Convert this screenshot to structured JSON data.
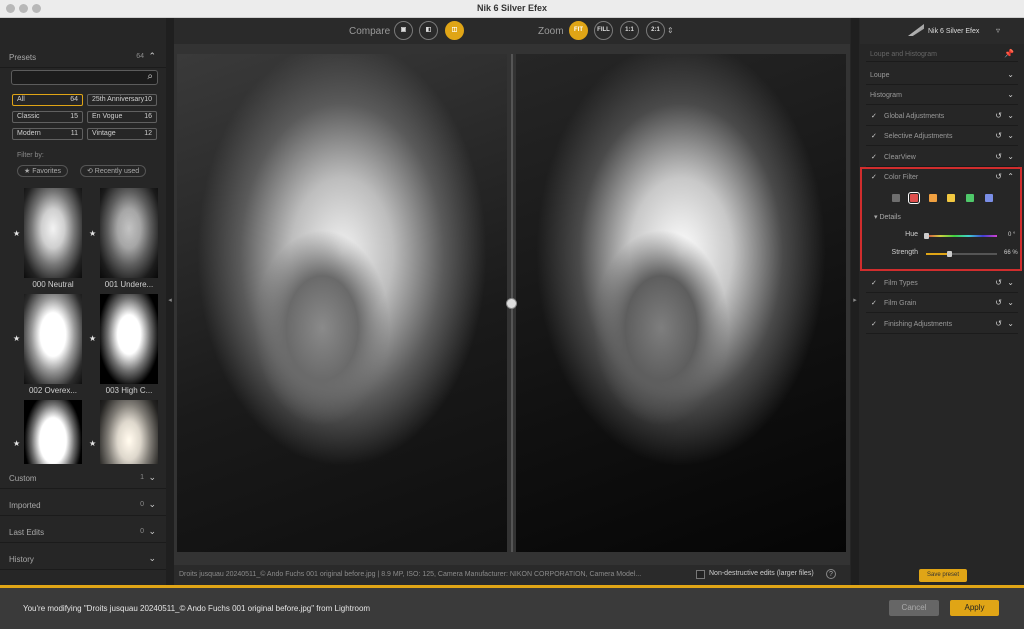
{
  "window": {
    "title": "Nik 6 Silver Efex"
  },
  "left": {
    "presets": {
      "label": "Presets",
      "count": "64"
    },
    "categories": [
      {
        "name": "All",
        "count": "64",
        "selected": true
      },
      {
        "name": "25th Anniversary",
        "count": "10"
      },
      {
        "name": "Classic",
        "count": "15"
      },
      {
        "name": "En Vogue",
        "count": "16"
      },
      {
        "name": "Modern",
        "count": "11"
      },
      {
        "name": "Vintage",
        "count": "12"
      }
    ],
    "filter_by": "Filter by:",
    "chips": {
      "favorites": "★ Favorites",
      "recent": "⟲ Recently used"
    },
    "thumbs": [
      "000 Neutral",
      "001 Undere...",
      "002 Overex...",
      "003 High C..."
    ],
    "sections": [
      {
        "label": "Custom",
        "count": "1"
      },
      {
        "label": "Imported",
        "count": "0"
      },
      {
        "label": "Last Edits",
        "count": "0"
      },
      {
        "label": "History",
        "count": ""
      }
    ]
  },
  "topbar": {
    "compare_label": "Compare",
    "zoom_label": "Zoom",
    "zoom_buttons": [
      "FIT",
      "FILL",
      "1:1",
      "2:1"
    ]
  },
  "infobar": {
    "text": "Droits jusquau 20240511_© Ando Fuchs 001 original before.jpg   |   8.9 MP, ISO: 125, Camera Manufacturer: NIKON CORPORATION, Camera Model...",
    "nondestructive": "Non-destructive edits (larger files)",
    "help": "?"
  },
  "right": {
    "header": {
      "name": "Nik 6 Silver Efex"
    },
    "loupe_hist": "Loupe and Histogram",
    "rows": [
      {
        "label": "Loupe",
        "check": false
      },
      {
        "label": "Histogram",
        "check": false
      },
      {
        "label": "Global Adjustments",
        "check": true
      },
      {
        "label": "Selective Adjustments",
        "check": true
      },
      {
        "label": "ClearView",
        "check": true
      },
      {
        "label": "Color Filter",
        "check": true
      }
    ],
    "color_filter": {
      "swatches": [
        "#6e6e6e",
        "#e0504e",
        "#f0a040",
        "#f2c840",
        "#4fc86a",
        "#7a8ee6"
      ],
      "details": "▾ Details",
      "hue_label": "Hue",
      "hue_value": "0 °",
      "hue_level": 0.0,
      "strength_label": "Strength",
      "strength_value": "66 %",
      "strength_level": 0.33
    },
    "rows_after": [
      {
        "label": "Film Types"
      },
      {
        "label": "Film Grain"
      },
      {
        "label": "Finishing Adjustments"
      }
    ],
    "save_preset": "Save preset"
  },
  "bottom": {
    "message": "You're modifying \"Droits jusquau 20240511_© Ando Fuchs 001 original before.jpg\" from Lightroom",
    "cancel": "Cancel",
    "apply": "Apply"
  }
}
